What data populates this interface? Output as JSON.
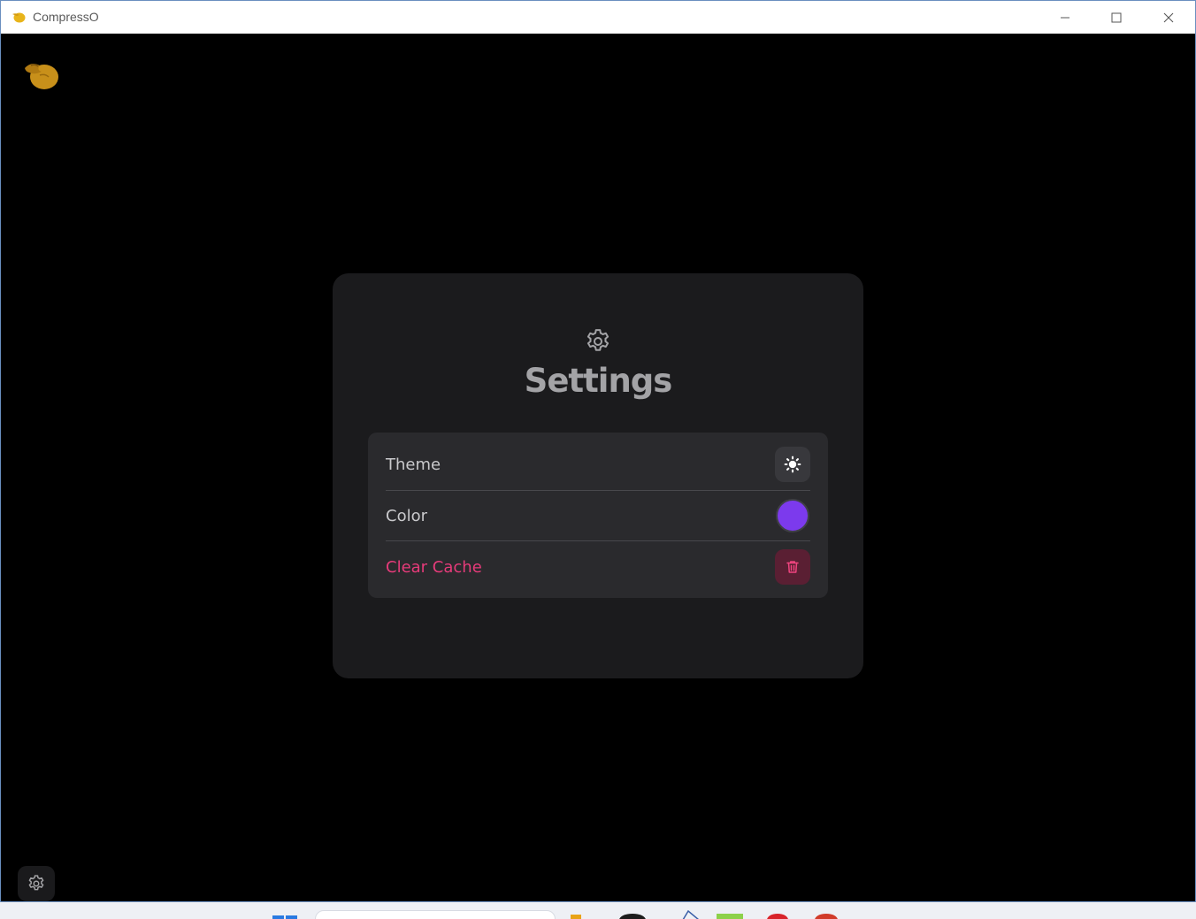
{
  "window": {
    "title": "CompressO",
    "controls": {
      "minimize_icon": "minimize-icon",
      "maximize_icon": "maximize-icon",
      "close_icon": "close-icon"
    }
  },
  "app": {
    "logo_icon": "compresso-logo",
    "settings_button_icon": "gear-icon"
  },
  "settings": {
    "heading_icon": "gear-icon",
    "title": "Settings",
    "rows": [
      {
        "label": "Theme",
        "control_icon": "sun-icon"
      },
      {
        "label": "Color",
        "control_value": "#7c3aed"
      },
      {
        "label": "Clear Cache",
        "control_icon": "trash-icon"
      }
    ]
  },
  "colors": {
    "accent": "#7c3aed",
    "danger": "#e63b7a",
    "logo": "#d4a017"
  }
}
